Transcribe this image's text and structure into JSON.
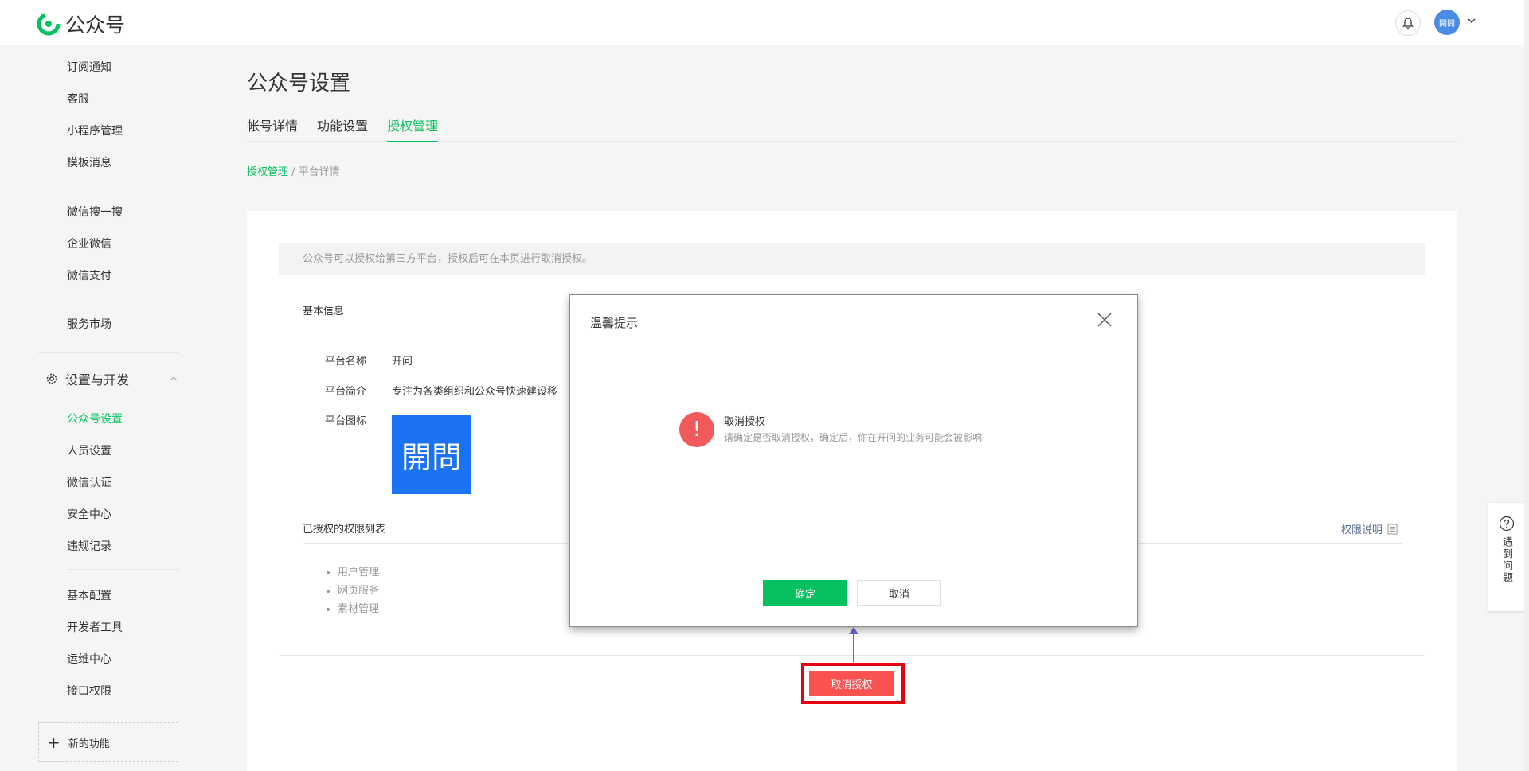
{
  "header": {
    "brand": "公众号",
    "avatar_text": "開問"
  },
  "sidebar": {
    "group1": [
      "订阅通知",
      "客服",
      "小程序管理",
      "模板消息"
    ],
    "group2": [
      "微信搜一搜",
      "企业微信",
      "微信支付"
    ],
    "group3": [
      "服务市场"
    ],
    "section_title": "设置与开发",
    "group4": [
      "公众号设置",
      "人员设置",
      "微信认证",
      "安全中心",
      "违规记录"
    ],
    "group5": [
      "基本配置",
      "开发者工具",
      "运维中心",
      "接口权限"
    ],
    "new_feature": "新的功能"
  },
  "page": {
    "title": "公众号设置",
    "tabs": [
      "帐号详情",
      "功能设置",
      "授权管理"
    ],
    "active_tab": "授权管理",
    "breadcrumb": {
      "link": "授权管理",
      "sep": " / ",
      "current": "平台详情"
    }
  },
  "card": {
    "notice": "公众号可以授权给第三方平台，授权后可在本页进行取消授权。",
    "basic_info_title": "基本信息",
    "platform_name_label": "平台名称",
    "platform_name": "开问",
    "platform_intro_label": "平台简介",
    "platform_intro": "专注为各类组织和公众号快速建设移",
    "platform_icon_label": "平台图标",
    "platform_icon_text": "開問",
    "perm_title": "已授权的权限列表",
    "perm_link": "权限说明",
    "permissions": [
      "用户管理",
      "网页服务",
      "素材管理"
    ],
    "revoke_button": "取消授权"
  },
  "dialog": {
    "title": "温馨提示",
    "heading": "取消授权",
    "message": "请确定是否取消授权，确定后，你在开问的业务可能会被影响",
    "ok": "确定",
    "cancel": "取消"
  },
  "help": {
    "label": "遇到问题"
  },
  "colors": {
    "accent": "#07c160",
    "danger": "#fa5151",
    "highlight": "#e60012"
  }
}
